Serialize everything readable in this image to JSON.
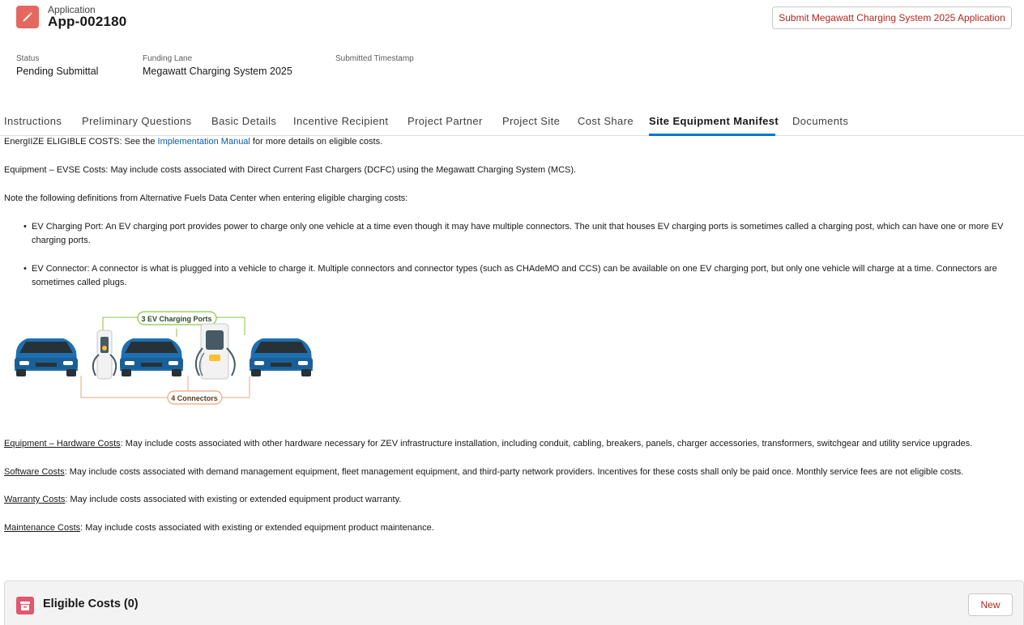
{
  "header": {
    "object_label": "Application",
    "record_name": "App-002180",
    "record_icon": "pencil-icon",
    "submit_button": "Submit Megawatt Charging System 2025 Application"
  },
  "fields": [
    {
      "label": "Status",
      "value": "Pending Submittal"
    },
    {
      "label": "Funding Lane",
      "value": "Megawatt Charging System 2025"
    },
    {
      "label": "Submitted Timestamp",
      "value": ""
    }
  ],
  "tabs": [
    {
      "label": "Instructions",
      "active": false
    },
    {
      "label": "Preliminary Questions",
      "active": false
    },
    {
      "label": "Basic Details",
      "active": false
    },
    {
      "label": "Incentive Recipient",
      "active": false
    },
    {
      "label": "Project Partner",
      "active": false
    },
    {
      "label": "Project Site",
      "active": false
    },
    {
      "label": "Cost Share",
      "active": false
    },
    {
      "label": "Site Equipment Manifest",
      "active": true
    },
    {
      "label": "Documents",
      "active": false
    }
  ],
  "content": {
    "intro_prefix": "EnergIIZE ELIGIBLE COSTS: See the ",
    "intro_link": "Implementation Manual",
    "intro_suffix": " for more details on eligible costs.",
    "equipment_evse": "Equipment – EVSE Costs: May include costs associated with Direct Current Fast Chargers (DCFC) using the Megawatt Charging System (MCS).",
    "definitions_note": "Note the following definitions from Alternative Fuels Data Center when entering eligible charging costs:",
    "bullets": [
      "EV Charging Port: An EV charging port provides power to charge only one vehicle at a time even though it may have multiple connectors. The unit that houses EV charging ports is sometimes called a charging post, which can have one or more EV charging ports.",
      "EV Connector: A connector is what is plugged into a vehicle to charge it. Multiple connectors and connector types (such as CHAdeMO and CCS) can be available on one EV charging port, but only one vehicle will charge at a time. Connectors are sometimes called plugs."
    ],
    "diagram": {
      "ports_label": "3 EV Charging Ports",
      "connectors_label": "4 Connectors"
    },
    "hardware_term": "Equipment – Hardware Costs",
    "hardware_text": ": May include costs associated with other hardware necessary for ZEV infrastructure installation, including conduit, cabling, breakers, panels, charger accessories, transformers, switchgear and utility service upgrades.",
    "software_term": "Software Costs",
    "software_text": ": May include costs associated with demand management equipment, fleet management equipment, and third-party network providers. Incentives for these costs shall only be paid once. Monthly service fees are not eligible costs.",
    "warranty_term": "Warranty Costs",
    "warranty_text": ": May include costs associated with existing or extended equipment product warranty.",
    "maintenance_term": "Maintenance Costs",
    "maintenance_text": ": May include costs associated with existing or extended equipment product maintenance."
  },
  "related_list": {
    "title": "Eligible Costs (0)",
    "icon": "archive-icon",
    "new_button": "New"
  },
  "colors": {
    "brand_blue": "#0176d3",
    "link": "#0b5cab",
    "record_icon_bg": "#e5685e",
    "related_icon_bg": "#e3566c",
    "button_text": "#b3261e"
  }
}
